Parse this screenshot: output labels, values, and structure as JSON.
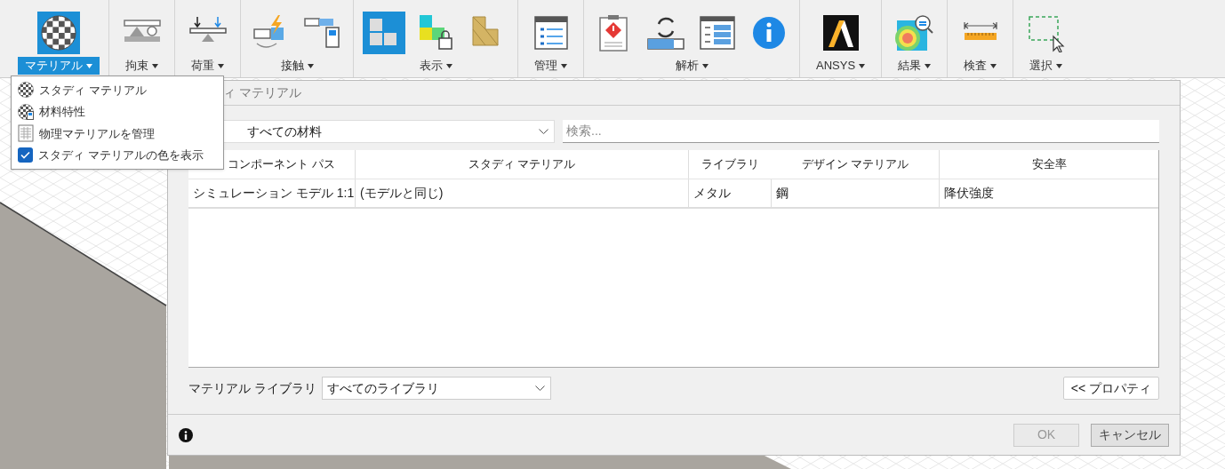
{
  "toolbar": {
    "groups": [
      {
        "label": "マテリアル",
        "selected": true,
        "tools": [
          {
            "kind": "checker-sphere",
            "selected": true
          }
        ]
      },
      {
        "label": "拘束",
        "selected": false,
        "tools": [
          {
            "kind": "constraint",
            "selected": false
          }
        ]
      },
      {
        "label": "荷重",
        "selected": false,
        "tools": [
          {
            "kind": "load",
            "selected": false
          }
        ]
      },
      {
        "label": "接触",
        "selected": false,
        "tools": [
          {
            "kind": "contact",
            "selected": false
          },
          {
            "kind": "contact-manager",
            "selected": false
          }
        ]
      },
      {
        "label": "表示",
        "selected": false,
        "tools": [
          {
            "kind": "blocks",
            "selected": true
          },
          {
            "kind": "locked-blocks",
            "selected": false
          },
          {
            "kind": "tan-blocks",
            "selected": false
          }
        ]
      },
      {
        "label": "管理",
        "selected": false,
        "tools": [
          {
            "kind": "list-window",
            "selected": false
          }
        ]
      },
      {
        "label": "解析",
        "selected": false,
        "tools": [
          {
            "kind": "clipboard-warning",
            "selected": false
          },
          {
            "kind": "refresh-bar",
            "selected": false
          },
          {
            "kind": "list-window-blue",
            "selected": false
          },
          {
            "kind": "info",
            "selected": false
          }
        ]
      },
      {
        "label": "ANSYS",
        "selected": false,
        "tools": [
          {
            "kind": "ansys",
            "selected": false
          }
        ]
      },
      {
        "label": "結果",
        "selected": false,
        "tools": [
          {
            "kind": "heatmap",
            "selected": false
          }
        ]
      },
      {
        "label": "検査",
        "selected": false,
        "tools": [
          {
            "kind": "ruler",
            "selected": false
          }
        ]
      },
      {
        "label": "選択",
        "selected": false,
        "tools": [
          {
            "kind": "select-box",
            "selected": false
          }
        ]
      }
    ]
  },
  "menu": {
    "items": [
      {
        "label": "スタディ マテリアル",
        "kind": "checker"
      },
      {
        "label": "材料特性",
        "kind": "properties"
      },
      {
        "label": "物理マテリアルを管理",
        "kind": "manage"
      },
      {
        "label": "スタディ マテリアルの色を表示",
        "kind": "checkbox",
        "checked": true
      }
    ]
  },
  "dialog": {
    "title": "ィ マテリアル",
    "filter": {
      "value": "すべての材料"
    },
    "search": {
      "placeholder": "検索..."
    },
    "table": {
      "columns": [
        "コンポーネント パス",
        "スタディ マテリアル",
        "ライブラリ",
        "デザイン マテリアル",
        "安全率"
      ],
      "rows": [
        [
          "シミュレーション モデル 1:1",
          "(モデルと同じ)",
          "メタル",
          "鋼",
          "降伏強度"
        ]
      ]
    },
    "library_label": "マテリアル ライブラリ",
    "library": {
      "value": "すべてのライブラリ"
    },
    "properties_button": "<< プロパティ",
    "buttons": [
      {
        "label": "OK",
        "disabled": true
      },
      {
        "label": "キャンセル",
        "disabled": false
      }
    ]
  }
}
